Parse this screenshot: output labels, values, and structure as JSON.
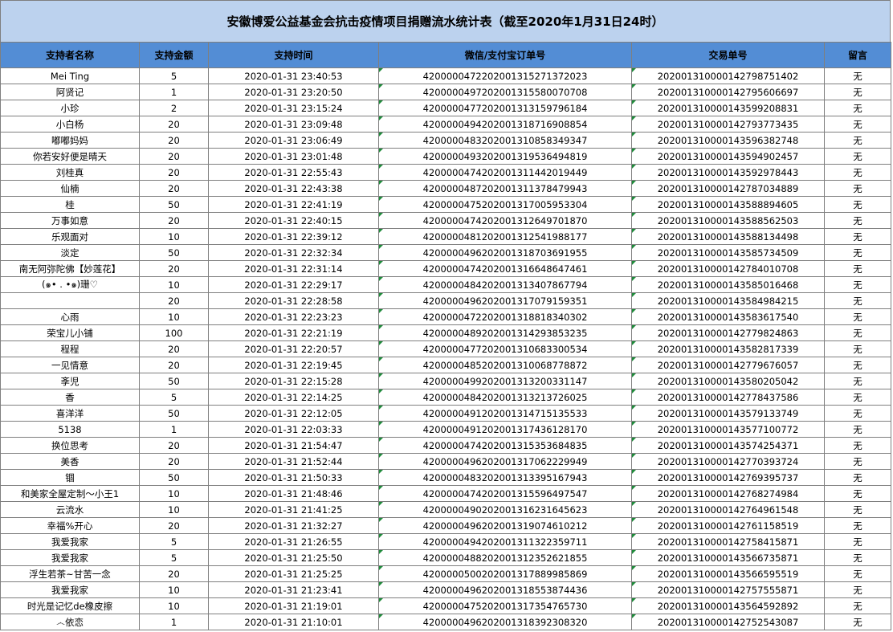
{
  "title": "安徽博爱公益基金会抗击疫情项目捐赠流水统计表（截至2020年1月31日24时）",
  "colors": {
    "title_bg": "#BCD2EE",
    "header_bg": "#538DD5",
    "cell_marker": "#1e8a3a"
  },
  "headers": [
    "支持者名称",
    "支持金额",
    "支持时间",
    "微信/支付宝订单号",
    "交易单号",
    "留言"
  ],
  "rows": [
    [
      "Mei Ting",
      "5",
      "2020-01-31 23:40:53",
      "4200000472202001315271372023",
      "2020013100001427987514O2",
      "无"
    ],
    [
      "阿贤记",
      "1",
      "2020-01-31 23:20:50",
      "4200000497202001315580070708",
      "2020013100001427956066​97",
      "无"
    ],
    [
      "小珍",
      "2",
      "2020-01-31 23:15:24",
      "4200000477202001313159796184",
      "2020013100001435992088​31",
      "无"
    ],
    [
      "小白杨",
      "20",
      "2020-01-31 23:09:48",
      "4200000494202001318716908854",
      "2020013100001427937734​35",
      "无"
    ],
    [
      "嘟嘟妈妈",
      "20",
      "2020-01-31 23:06:49",
      "4200000483202001310858349347",
      "2020013100001435963827​48",
      "无"
    ],
    [
      "你若安好便是晴天",
      "20",
      "2020-01-31 23:01:48",
      "4200000493202001319536494819",
      "2020013100001435949024​57",
      "无"
    ],
    [
      "刘桂真",
      "20",
      "2020-01-31 22:55:43",
      "4200000474202001311442019449",
      "2020013100001435929784​43",
      "无"
    ],
    [
      "仙楠",
      "20",
      "2020-01-31 22:43:38",
      "4200000487202001311378479943",
      "2020013100001427870348​89",
      "无"
    ],
    [
      "桂",
      "50",
      "2020-01-31 22:41:19",
      "4200000475202001317005953304",
      "2020013100001435888946​05",
      "无"
    ],
    [
      "万事如意",
      "20",
      "2020-01-31 22:40:15",
      "4200000474202001312649701870",
      "2020013100001435885625​03",
      "无"
    ],
    [
      "乐观面对",
      "10",
      "2020-01-31 22:39:12",
      "4200000481202001312541988177",
      "2020013100001435881344​98",
      "无"
    ],
    [
      "淡定",
      "50",
      "2020-01-31 22:32:34",
      "4200000496202001318703691955",
      "2020013100001435857345​09",
      "无"
    ],
    [
      "南无阿弥陀佛【妙莲花】",
      "20",
      "2020-01-31 22:31:14",
      "4200000474202001316648647461",
      "2020013100001427840107​08",
      "无"
    ],
    [
      "(๑• . •๑)珊♡",
      "10",
      "2020-01-31 22:29:17",
      "4200000484202001313407867794",
      "2020013100001435850164​68",
      "无"
    ],
    [
      "",
      "20",
      "2020-01-31 22:28:58",
      "4200000496202001317079159351",
      "2020013100001435849842​15",
      "无"
    ],
    [
      "心雨",
      "10",
      "2020-01-31 22:23:23",
      "4200000472202001318818340302",
      "2020013100001435836175​40",
      "无"
    ],
    [
      "荣宝儿小铺",
      "100",
      "2020-01-31 22:21:19",
      "4200000489202001314293853235",
      "2020013100001427798248​63",
      "无"
    ],
    [
      "程程",
      "20",
      "2020-01-31 22:20:57",
      "4200000477202001310683300534",
      "2020013100001435828173​39",
      "无"
    ],
    [
      "一见情意",
      "20",
      "2020-01-31 22:19:45",
      "4200000485202001310068778872",
      "2020013100001427796760​57",
      "无"
    ],
    [
      "斈児",
      "50",
      "2020-01-31 22:15:28",
      "4200000499202001313200331147",
      "2020013100001435802050​42",
      "无"
    ],
    [
      "香",
      "5",
      "2020-01-31 22:14:25",
      "4200000484202001313213726025",
      "2020013100001427784375​86",
      "无"
    ],
    [
      "喜洋洋",
      "50",
      "2020-01-31 22:12:05",
      "4200000491202001314715135533",
      "2020013100001435791337​49",
      "无"
    ],
    [
      "5138",
      "1",
      "2020-01-31 22:03:33",
      "4200000491202001317436128170",
      "2020013100001435771007​72",
      "无"
    ],
    [
      "换位思考",
      "20",
      "2020-01-31 21:54:47",
      "4200000474202001315353684835",
      "2020013100001435742543​71",
      "无"
    ],
    [
      "美香",
      "20",
      "2020-01-31 21:52:44",
      "4200000496202001317062229949",
      "2020013100001427703937​24",
      "无"
    ],
    [
      "锢",
      "50",
      "2020-01-31 21:50:33",
      "4200000483202001313395167943",
      "2020013100001427693957​37",
      "无"
    ],
    [
      "和美家全屋定制～小王1",
      "10",
      "2020-01-31 21:48:46",
      "4200000474202001315596497547",
      "2020013100001427682749​84",
      "无"
    ],
    [
      "云流水",
      "10",
      "2020-01-31 21:41:25",
      "4200000490202001316231645623",
      "2020013100001427649615​48",
      "无"
    ],
    [
      "幸福%开心",
      "20",
      "2020-01-31 21:32:27",
      "4200000496202001319074610212",
      "2020013100001427611585​19",
      "无"
    ],
    [
      "我爱我家",
      "5",
      "2020-01-31 21:26:55",
      "4200000494202001311322359711",
      "2020013100001427584158​71",
      "无"
    ],
    [
      "我爱我家",
      "5",
      "2020-01-31 21:25:50",
      "4200000488202001312352621855",
      "2020013100001435667358​71",
      "无"
    ],
    [
      "浮生若茶~甘苦一念",
      "20",
      "2020-01-31 21:25:25",
      "4200000500202001317889985869",
      "2020013100001435665955​19",
      "无"
    ],
    [
      "我爱我家",
      "10",
      "2020-01-31 21:23:41",
      "4200000496202001318553874436",
      "2020013100001427575558​71",
      "无"
    ],
    [
      "时光是记忆de橡皮擦",
      "10",
      "2020-01-31 21:19:01",
      "4200000475202001317354765730",
      "2020013100001435645928​92",
      "无"
    ],
    [
      "෴依恋",
      "1",
      "2020-01-31 21:10:01",
      "4200000496202001318392308320",
      "2020013100001427525430​87",
      "无"
    ]
  ]
}
